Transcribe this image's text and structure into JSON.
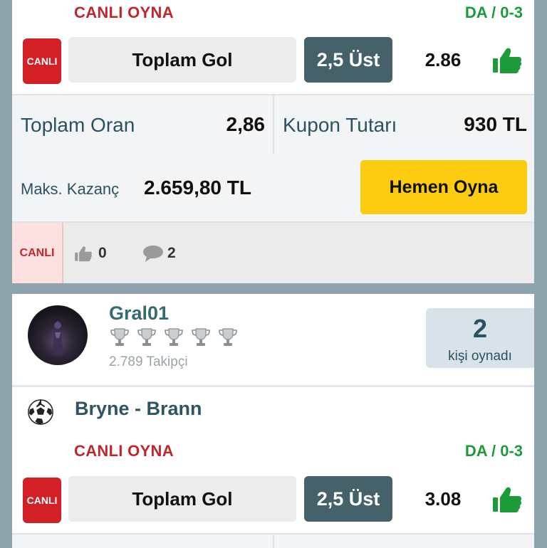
{
  "coupon1": {
    "live_play_label": "CANLI OYNA",
    "da_label": "DA / 0-3",
    "live_badge": "CANLI",
    "market": "Toplam Gol",
    "pick": "2,5 Üst",
    "odds": "2.86",
    "total_odds_label": "Toplam Oran",
    "total_odds_value": "2,86",
    "stake_label": "Kupon Tutarı",
    "stake_value": "930 TL",
    "max_win_label": "Maks. Kazanç",
    "max_win_value": "2.659,80 TL",
    "play_button": "Hemen Oyna",
    "live_tag": "CANLI",
    "likes": "0",
    "comments": "2"
  },
  "coupon2": {
    "username": "Gral01",
    "trophy_count": 5,
    "followers": "2.789 Takipçi",
    "played_count": "2",
    "played_label": "kişi oynadı",
    "match": "Bryne - Brann",
    "live_play_label": "CANLI OYNA",
    "da_label": "DA / 0-3",
    "live_badge": "CANLI",
    "market": "Toplam Gol",
    "pick": "2,5 Üst",
    "odds": "3.08"
  },
  "colors": {
    "live_red": "#d32026",
    "accent_green": "#1d9a3a",
    "pick_slate": "#45626a",
    "play_yellow": "#fccc10"
  },
  "icons": [
    "thumbs-up-icon",
    "comment-icon",
    "trophy-icon",
    "soccer-ball-icon"
  ]
}
